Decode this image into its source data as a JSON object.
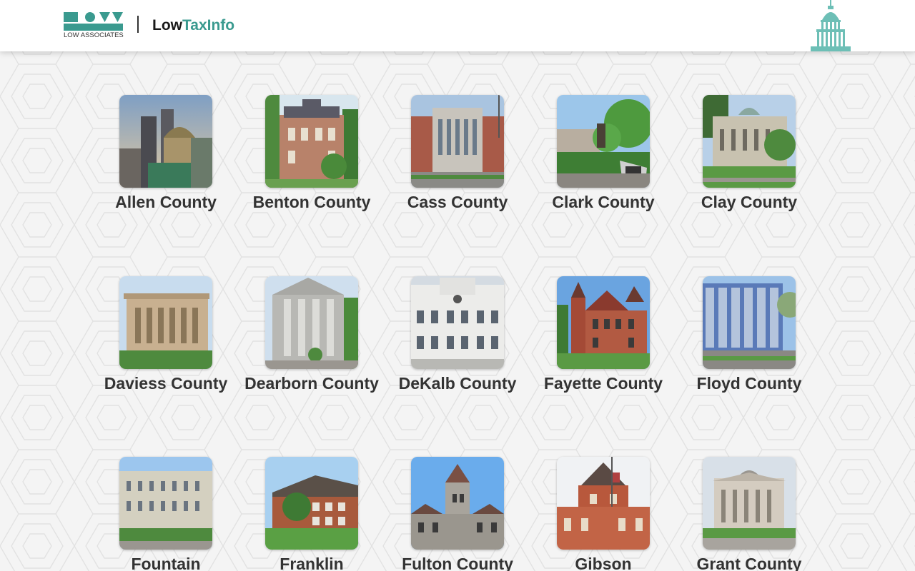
{
  "header": {
    "logo_subtitle": "LOW ASSOCIATES",
    "brand_part1": "Low",
    "brand_part2": "TaxInfo",
    "brand_color": "#3a9a8f"
  },
  "counties": [
    {
      "name": "Allen County"
    },
    {
      "name": "Benton County"
    },
    {
      "name": "Cass County"
    },
    {
      "name": "Clark County"
    },
    {
      "name": "Clay County"
    },
    {
      "name": "Daviess County"
    },
    {
      "name": "Dearborn County"
    },
    {
      "name": "DeKalb County"
    },
    {
      "name": "Fayette County"
    },
    {
      "name": "Floyd County"
    },
    {
      "name": "Fountain"
    },
    {
      "name": "Franklin"
    },
    {
      "name": "Fulton County"
    },
    {
      "name": "Gibson"
    },
    {
      "name": "Grant County"
    }
  ]
}
